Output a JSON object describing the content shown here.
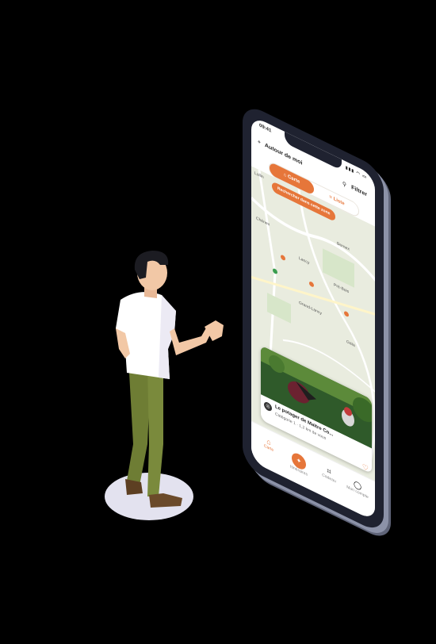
{
  "status_bar": {
    "time": "09:41",
    "signal": "▮▮▮ ◠ ▭"
  },
  "header": {
    "location_title": "Autour de moi",
    "filter_label": "Filtrer"
  },
  "view_switch": {
    "map_label": "Carte",
    "list_label": "Liste"
  },
  "map": {
    "search_button": "Rechercher dans cette zone",
    "labels": [
      "Lullin",
      "Bernex",
      "Chénex",
      "Lancy",
      "Pré-Bois",
      "Gaïa",
      "Grand-Lancy"
    ]
  },
  "place_card": {
    "name": "Le potager de Maïtre Co...",
    "subtitle": "Catégorie 1 · 1,2 km de vous"
  },
  "tabbar": {
    "items": [
      {
        "label": "Carte",
        "icon": "map-icon"
      },
      {
        "label": "Itinéraires",
        "icon": "route-icon"
      },
      {
        "label": "Cadeau",
        "icon": "gift-icon"
      },
      {
        "label": "Mon compte",
        "icon": "user-icon"
      }
    ]
  },
  "colors": {
    "accent": "#e6763a",
    "background": "#000000",
    "phone_frame": "#1f2230",
    "shirt": "#ffffff",
    "pants": "#7a8a3c",
    "shoes": "#6b4a2a",
    "shadow": "#e3e2ef"
  }
}
